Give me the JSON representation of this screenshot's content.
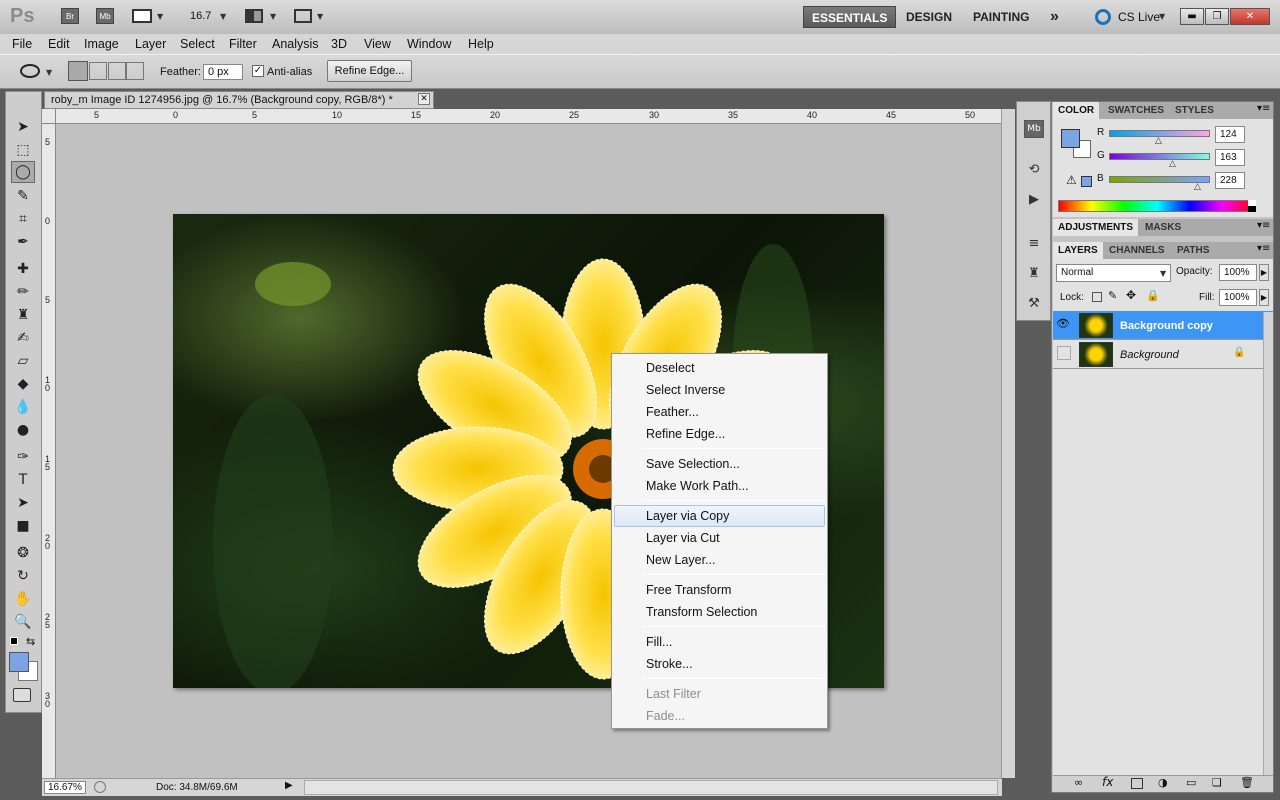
{
  "app": {
    "logo": "Ps",
    "bridge_icon": "Br",
    "minibridge_icon": "Mb",
    "zoom_value": "16.7"
  },
  "workspaces": [
    "ESSENTIALS",
    "DESIGN",
    "PAINTING"
  ],
  "workspace_more": "»",
  "cs_live": "CS Live",
  "window_controls": {
    "minimize": "▬",
    "restore": "❐",
    "close": "✕"
  },
  "menu": [
    "File",
    "Edit",
    "Image",
    "Layer",
    "Select",
    "Filter",
    "Analysis",
    "3D",
    "View",
    "Window",
    "Help"
  ],
  "options": {
    "feather_label": "Feather:",
    "feather_value": "0 px",
    "antialias_label": "Anti-alias",
    "antialias_checked": true,
    "refine_edge_label": "Refine Edge..."
  },
  "document": {
    "tab_title": "roby_m Image ID  1274956.jpg @ 16.7% (Background copy, RGB/8*) *",
    "close": "✕"
  },
  "ruler_h": [
    "5",
    "0",
    "5",
    "10",
    "15",
    "20",
    "25",
    "30",
    "35",
    "40",
    "45",
    "50"
  ],
  "ruler_v": [
    "5",
    "0",
    "5",
    "1 0",
    "1 5",
    "2 0",
    "2 5",
    "3 0"
  ],
  "status": {
    "zoom": "16.67%",
    "doc": "Doc: 34.8M/69.6M"
  },
  "context_menu": [
    {
      "label": "Deselect",
      "enabled": true
    },
    {
      "label": "Select Inverse",
      "enabled": true
    },
    {
      "label": "Feather...",
      "enabled": true
    },
    {
      "label": "Refine Edge...",
      "enabled": true
    },
    {
      "sep": true
    },
    {
      "label": "Save Selection...",
      "enabled": true
    },
    {
      "label": "Make Work Path...",
      "enabled": true
    },
    {
      "sep": true
    },
    {
      "label": "Layer via Copy",
      "enabled": true,
      "highlighted": true
    },
    {
      "label": "Layer via Cut",
      "enabled": true
    },
    {
      "label": "New Layer...",
      "enabled": true
    },
    {
      "sep": true
    },
    {
      "label": "Free Transform",
      "enabled": true
    },
    {
      "label": "Transform Selection",
      "enabled": true
    },
    {
      "sep": true
    },
    {
      "label": "Fill...",
      "enabled": true
    },
    {
      "label": "Stroke...",
      "enabled": true
    },
    {
      "sep": true
    },
    {
      "label": "Last Filter",
      "enabled": false
    },
    {
      "label": "Fade...",
      "enabled": false
    }
  ],
  "color_panel": {
    "tabs": [
      "COLOR",
      "SWATCHES",
      "STYLES"
    ],
    "r_label": "R",
    "g_label": "G",
    "b_label": "B",
    "r": 124,
    "g": 163,
    "b": 228,
    "foreground": "#7ca3e4"
  },
  "adjustments_tabs": [
    "ADJUSTMENTS",
    "MASKS"
  ],
  "layers_panel": {
    "tabs": [
      "LAYERS",
      "CHANNELS",
      "PATHS"
    ],
    "blend_mode": "Normal",
    "opacity_label": "Opacity:",
    "opacity": "100%",
    "lock_label": "Lock:",
    "fill_label": "Fill:",
    "fill": "100%",
    "layers": [
      {
        "name": "Background copy",
        "selected": true,
        "visible": true
      },
      {
        "name": "Background",
        "selected": false,
        "visible": false,
        "locked": true
      }
    ]
  },
  "colors": {
    "selection_blue": "#3d96f5",
    "accent_blue": "#7ca3e4"
  }
}
